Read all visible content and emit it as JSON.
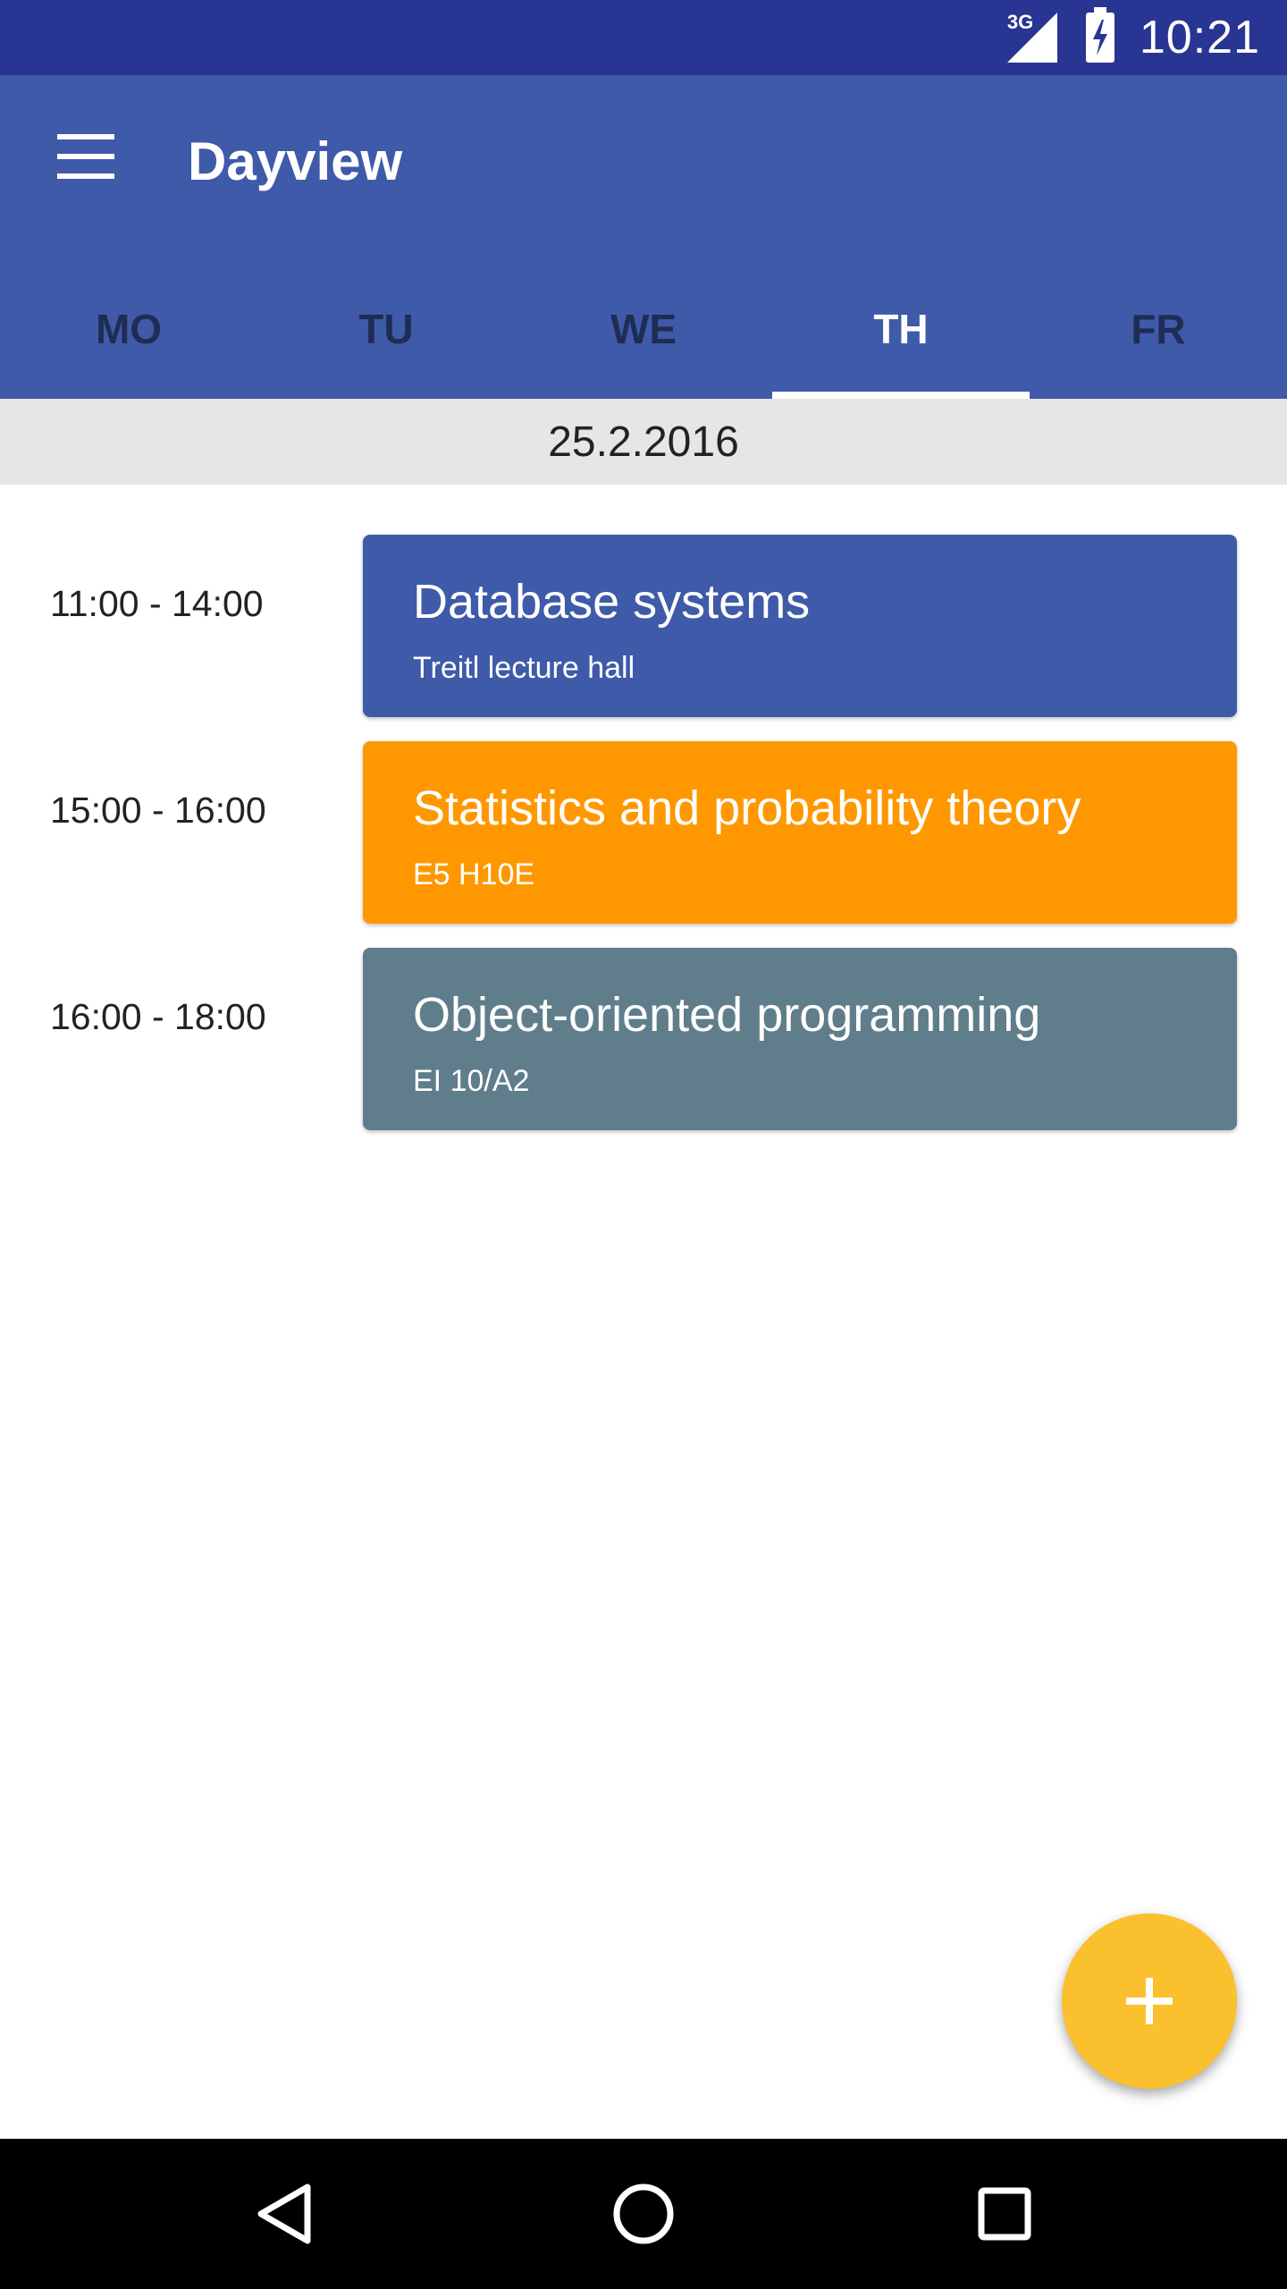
{
  "status_bar": {
    "network_label": "3G",
    "time": "10:21",
    "background": "#283593"
  },
  "app_bar": {
    "title": "Dayview",
    "background": "#3f5aa8"
  },
  "tabs": [
    {
      "label": "MO",
      "active": false
    },
    {
      "label": "TU",
      "active": false
    },
    {
      "label": "WE",
      "active": false
    },
    {
      "label": "TH",
      "active": true
    },
    {
      "label": "FR",
      "active": false
    }
  ],
  "date": "25.2.2016",
  "events": [
    {
      "time": "11:00 - 14:00",
      "title": "Database systems",
      "room": "Treitl lecture hall",
      "color": "#3f5aa8"
    },
    {
      "time": "15:00 - 16:00",
      "title": "Statistics and probability theory",
      "room": "E5 H10E",
      "color": "#ff9800"
    },
    {
      "time": "16:00 - 18:00",
      "title": "Object-oriented programming",
      "room": "EI 10/A2",
      "color": "#607d8b"
    }
  ],
  "fab": {
    "icon": "plus-icon",
    "color": "#fbc02d"
  },
  "nav_bar": {
    "icons": [
      "back-icon",
      "home-icon",
      "recents-icon"
    ]
  }
}
